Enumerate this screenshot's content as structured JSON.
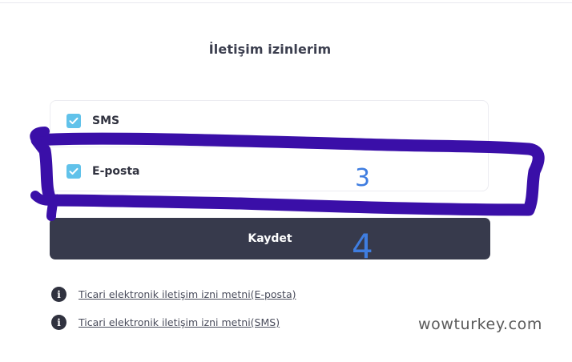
{
  "section": {
    "title": "İletişim izinlerim"
  },
  "permissions": [
    {
      "label": "SMS",
      "checked": true
    },
    {
      "label": "E-posta",
      "checked": true
    }
  ],
  "save_button": {
    "label": "Kaydet",
    "color": "#373a4c"
  },
  "links": [
    {
      "label": "Ticari elektronik iletişim izni metni(E-posta)",
      "icon": "info-icon"
    },
    {
      "label": "Ticari elektronik iletişim izni metni(SMS)",
      "icon": "info-icon"
    }
  ],
  "watermark": "wowturkey.com",
  "annotations": {
    "email_row_number": "3",
    "save_button_number": "4",
    "marker_color": "#3a0fa8",
    "digit_color": "#3f7de0"
  },
  "colors": {
    "checkbox": "#61c2ea",
    "text": "#30323f"
  }
}
